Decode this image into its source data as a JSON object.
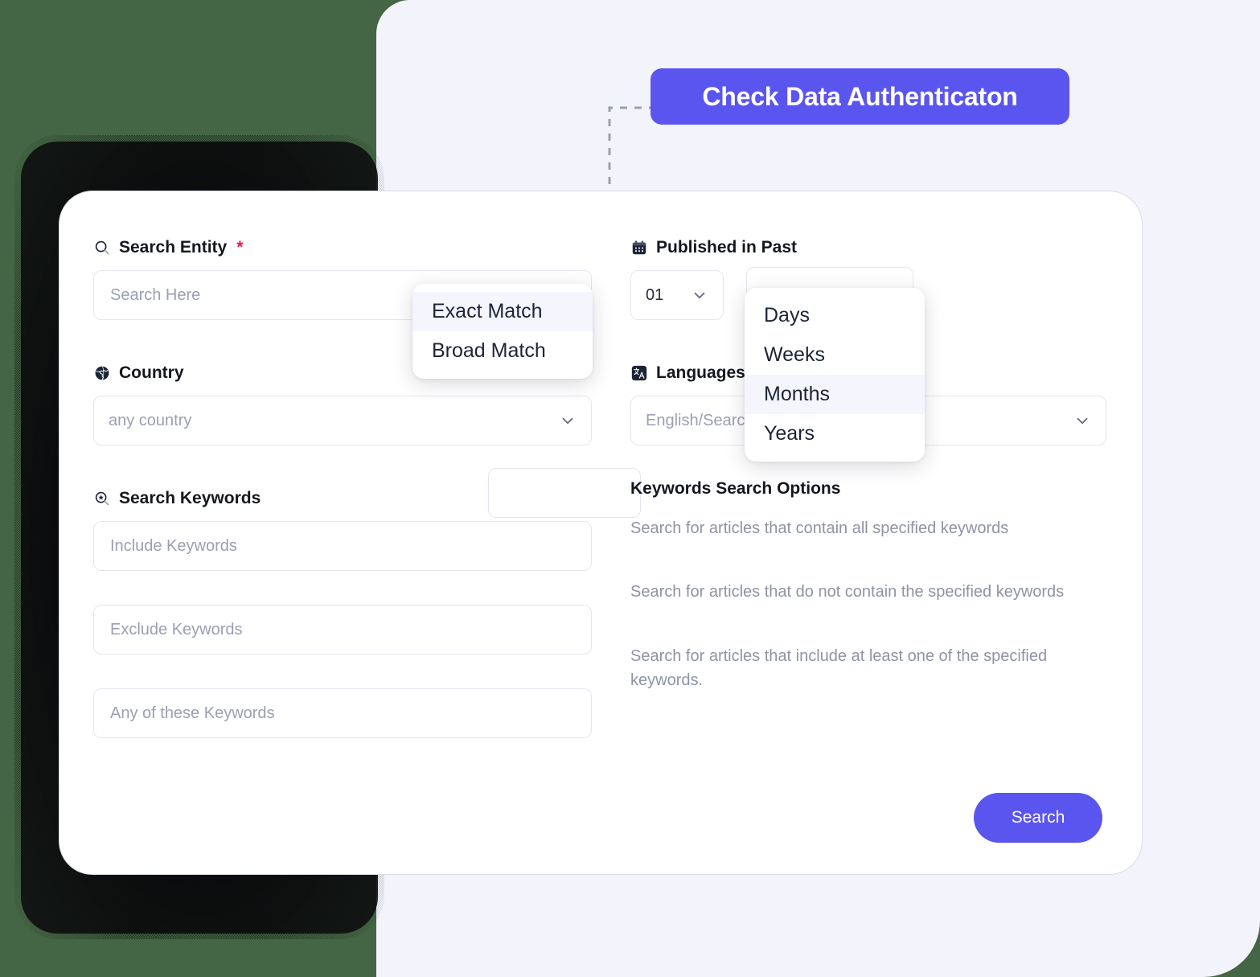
{
  "cta": {
    "label": "Check Data Authenticaton",
    "color": "#5b55ef"
  },
  "card": {
    "left_column": {
      "search_entity": {
        "icon": "search-icon",
        "label": "Search Entity",
        "required_marker": "*",
        "input_placeholder": "Search Here",
        "match_select_placeholder": ""
      },
      "country": {
        "icon": "globe-icon",
        "label": "Country",
        "select_value": "any country"
      },
      "search_keywords": {
        "icon": "keyword-search-icon",
        "label": "Search Keywords",
        "include_placeholder": "Include Keywords",
        "exclude_placeholder": "Exclude Keywords",
        "any_placeholder": "Any of these Keywords"
      }
    },
    "right_column": {
      "published_in_past": {
        "icon": "calendar-icon",
        "label": "Published in Past",
        "count_value": "01",
        "unit_value": ""
      },
      "languages": {
        "icon": "translate-icon",
        "label": "Languages",
        "select_placeholder": "English/Search Language"
      },
      "keywords_search_options": {
        "title": "Keywords Search Options",
        "descriptions": [
          "Search for articles that contain all specified keywords",
          "Search for articles that do not contain the specified keywords",
          "Search for articles that include at least one of the specified keywords."
        ]
      }
    },
    "submit": {
      "label": "Search",
      "color": "#5b55ef"
    }
  },
  "menus": {
    "match_type": {
      "items": [
        {
          "label": "Exact Match",
          "active": true
        },
        {
          "label": "Broad Match",
          "active": false
        }
      ]
    },
    "time_period": {
      "items": [
        {
          "label": "Days",
          "active": false
        },
        {
          "label": "Weeks",
          "active": false
        },
        {
          "label": "Months",
          "active": true
        },
        {
          "label": "Years",
          "active": false
        }
      ]
    }
  },
  "colors": {
    "accent": "#5b55ef",
    "page_background": "#f3f3fb",
    "card_background": "#ffffff",
    "required_asterisk": "#e8174a",
    "placeholder_text": "#9b9fb3",
    "muted_text": "#8e93a6"
  }
}
